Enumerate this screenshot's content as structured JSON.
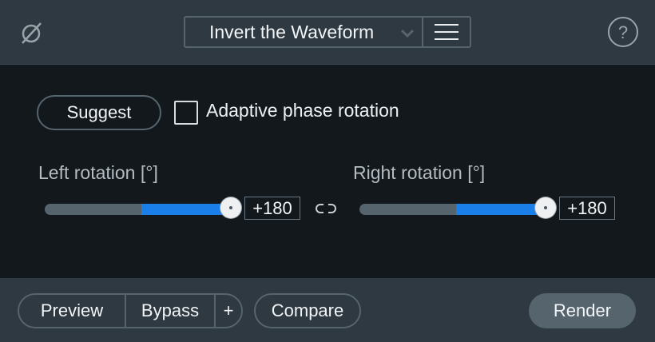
{
  "header": {
    "module_icon": "phase-invert-icon",
    "preset_name": "Invert the Waveform",
    "preset_dropdown_icon": "chevron-down-icon",
    "menu_icon": "hamburger-menu-icon",
    "help_icon": "help-icon"
  },
  "controls": {
    "suggest_label": "Suggest",
    "adaptive_label": "Adaptive phase rotation",
    "adaptive_checked": false,
    "left": {
      "label": "Left rotation [°]",
      "value": "+180",
      "min": -180,
      "max": 180,
      "current": 180
    },
    "right": {
      "label": "Right rotation [°]",
      "value": "+180",
      "min": -180,
      "max": 180,
      "current": 180
    },
    "link_icon": "link-icon"
  },
  "footer": {
    "preview_label": "Preview",
    "bypass_label": "Bypass",
    "plus_label": "+",
    "compare_label": "Compare",
    "render_label": "Render"
  },
  "colors": {
    "accent": "#1a7fe8",
    "panel": "#2e3941",
    "background": "#12181c"
  }
}
